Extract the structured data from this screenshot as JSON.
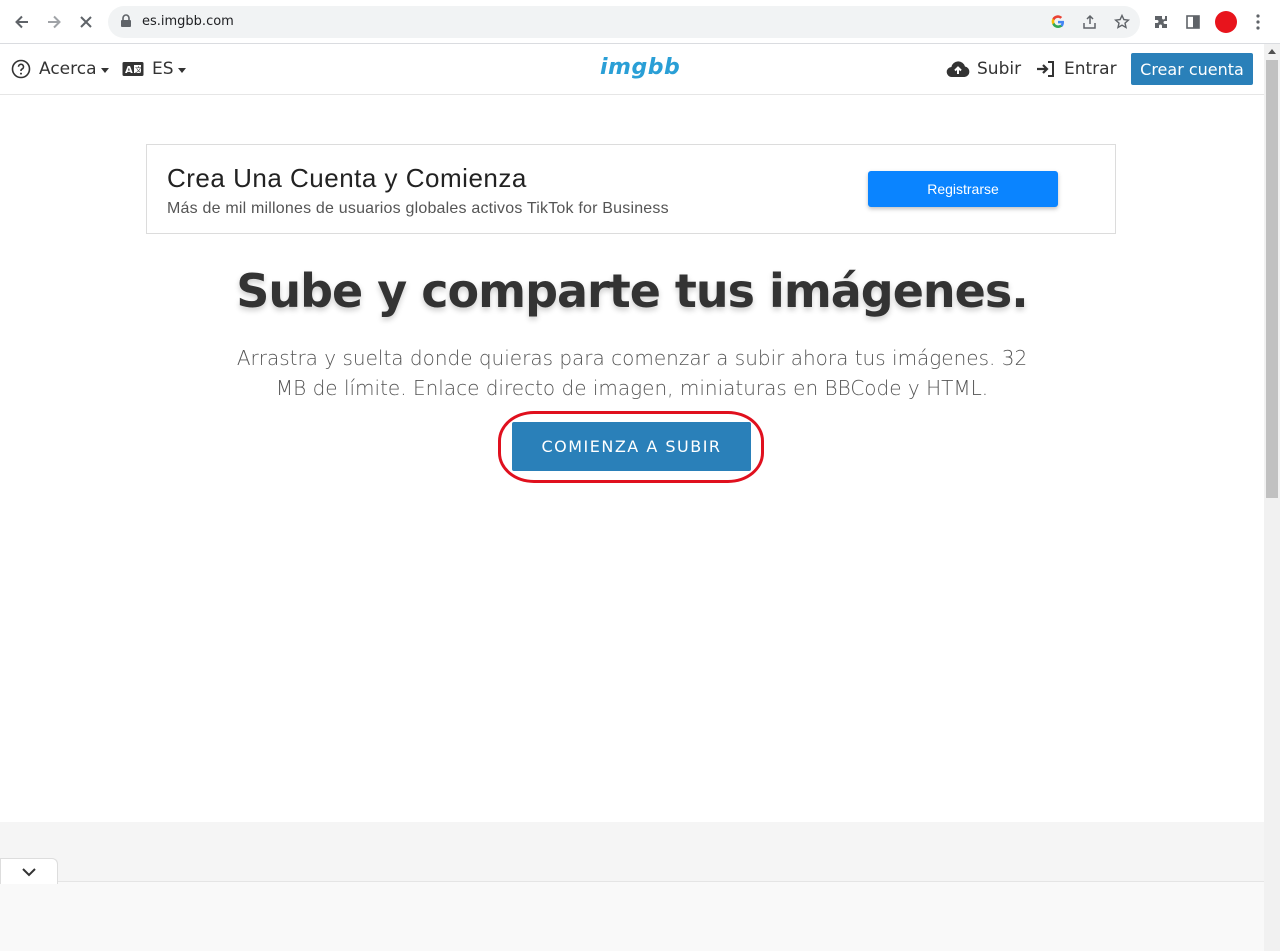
{
  "browser": {
    "url": "es.imgbb.com"
  },
  "header": {
    "about_label": "Acerca",
    "language_label": "ES",
    "logo_text": "imgbb",
    "upload_label": "Subir",
    "login_label": "Entrar",
    "create_account_label": "Crear cuenta"
  },
  "ad": {
    "title": "Crea Una Cuenta y Comienza",
    "subtitle": "Más de mil millones de usuarios globales activos TikTok for Business",
    "button_label": "Registrarse"
  },
  "hero": {
    "title": "Sube y comparte tus imágenes.",
    "description": "Arrastra y suelta donde quieras para comenzar a subir ahora tus imágenes. 32 MB de límite. Enlace directo de imagen, miniaturas en BBCode y HTML.",
    "cta_label": "COMIENZA A SUBIR"
  },
  "colors": {
    "brand": "#2a9fd6",
    "primary_button": "#2a80b9",
    "ad_button": "#0a84ff",
    "highlight_circle": "#e0101e"
  },
  "icons": [
    "back-arrow-icon",
    "forward-arrow-icon",
    "stop-loading-icon",
    "lock-icon",
    "google-icon",
    "share-icon",
    "bookmark-star-icon",
    "extensions-icon",
    "side-panel-icon",
    "profile-avatar",
    "menu-dots-icon",
    "help-circle-icon",
    "language-icon",
    "cloud-upload-icon",
    "sign-in-icon",
    "chevron-down-icon"
  ]
}
